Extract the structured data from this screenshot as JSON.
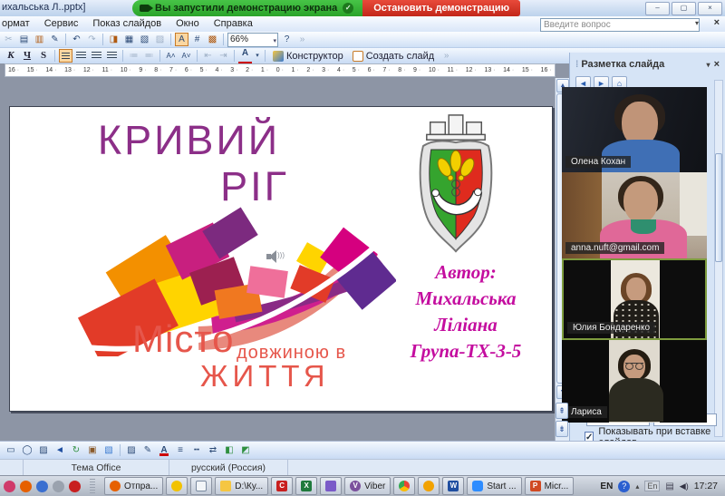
{
  "window": {
    "title": "ихальська Л..pptx]",
    "question_placeholder": "Введите вопрос"
  },
  "banner": {
    "message": "Вы запустили демонстрацию экрана",
    "stop_label": "Остановить демонстрацию"
  },
  "menubar": {
    "items": [
      "ормат",
      "Сервис",
      "Показ слайдов",
      "Окно",
      "Справка"
    ]
  },
  "toolbar": {
    "zoom_value": "66%",
    "bold_italic": "К",
    "underline": "Ч",
    "shadow": "S",
    "designer_label": "Конструктор",
    "new_slide_label": "Создать слайд"
  },
  "ruler": [
    "16",
    "15",
    "14",
    "13",
    "12",
    "11",
    "10",
    "9",
    "8",
    "7",
    "6",
    "5",
    "4",
    "3",
    "2",
    "1",
    "0",
    "1",
    "2",
    "3",
    "4",
    "5",
    "6",
    "7",
    "8",
    "9",
    "10",
    "11",
    "12",
    "13",
    "14",
    "15",
    "16"
  ],
  "slide": {
    "title_line1": "КРИВИЙ",
    "title_line2": "РІГ",
    "subtitle_word1": "Місто",
    "subtitle_word2": "довжиною в",
    "subtitle_word3": "ЖИТТЯ",
    "author_lines": [
      "Автор:",
      "Михальська",
      "Ліліана",
      "Група-ТХ-3-5"
    ]
  },
  "task_pane": {
    "title": "Разметка слайда",
    "checkbox_label": "Показывать при вставке слайдов",
    "checkbox_checked": true
  },
  "participants": [
    {
      "name": "Олена Кохан"
    },
    {
      "name": "anna.nuft@gmail.com"
    },
    {
      "name": "Юлия Бондаренко",
      "active": true
    },
    {
      "name": "Лариса"
    }
  ],
  "status_bar": {
    "theme": "Тема Office",
    "language": "русский (Россия)"
  },
  "taskbar": {
    "quicklaunch": [
      "launcher",
      "firefox",
      "opera",
      "agent",
      "comodo"
    ],
    "buttons": [
      {
        "icon": "firefox",
        "label": "Отпра...",
        "glyph": ""
      },
      {
        "icon": "chick",
        "label": "",
        "glyph": ""
      },
      {
        "icon": "document",
        "label": "",
        "glyph": ""
      },
      {
        "icon": "folder",
        "label": "D:\\Ку...",
        "glyph": ""
      },
      {
        "icon": "redc",
        "label": "",
        "glyph": "C"
      },
      {
        "icon": "excel",
        "label": "",
        "glyph": "X"
      },
      {
        "icon": "media",
        "label": "",
        "glyph": ""
      },
      {
        "icon": "viber",
        "label": "Viber",
        "glyph": "V"
      },
      {
        "icon": "chrome",
        "label": "",
        "glyph": ""
      },
      {
        "icon": "mail",
        "label": "",
        "glyph": ""
      },
      {
        "icon": "word",
        "label": "",
        "glyph": "W"
      },
      {
        "icon": "zoom",
        "label": "Start ...",
        "glyph": ""
      },
      {
        "icon": "ppt",
        "label": "Micr...",
        "glyph": "P"
      }
    ],
    "tray": {
      "lang": "EN",
      "lang2": "En",
      "time": "17:27"
    }
  },
  "icons": {
    "scissors": "✂",
    "copy": "▤",
    "paste": "▥",
    "format-painter": "✎",
    "undo": "↶",
    "redo": "↷",
    "insert-chart": "◨",
    "insert-table": "▦",
    "insert-sheet": "▧",
    "expand": "▨",
    "show-formatting": "A",
    "grid": "#",
    "color-scheme": "▩",
    "help": "?",
    "overflow": "»",
    "dropdown": "▾",
    "close": "×",
    "minimize": "–",
    "maximize": "▢",
    "back": "◄",
    "forward": "►",
    "home": "⌂",
    "check": "✓",
    "scroll-up": "▲",
    "scroll-down": "▼",
    "prev-slide": "⇞",
    "next-slide": "⇟",
    "rect": "▭",
    "oval": "◯",
    "picture": "▨",
    "media": "◄",
    "rotate": "↻",
    "person": "▣",
    "picture2": "▧",
    "fill": "▨",
    "line-color": "✎",
    "font-color": "А",
    "line-style": "≡",
    "dash-style": "╍",
    "arrow-style": "⇄",
    "shadow-style": "◧",
    "threed": "◩",
    "fontup": "A˄",
    "fontdn": "A˅",
    "numlist": "≔",
    "bullist": "≕",
    "outdent": "⇤",
    "indent": "⇥",
    "toolbox": "",
    "slide-ico": ""
  }
}
